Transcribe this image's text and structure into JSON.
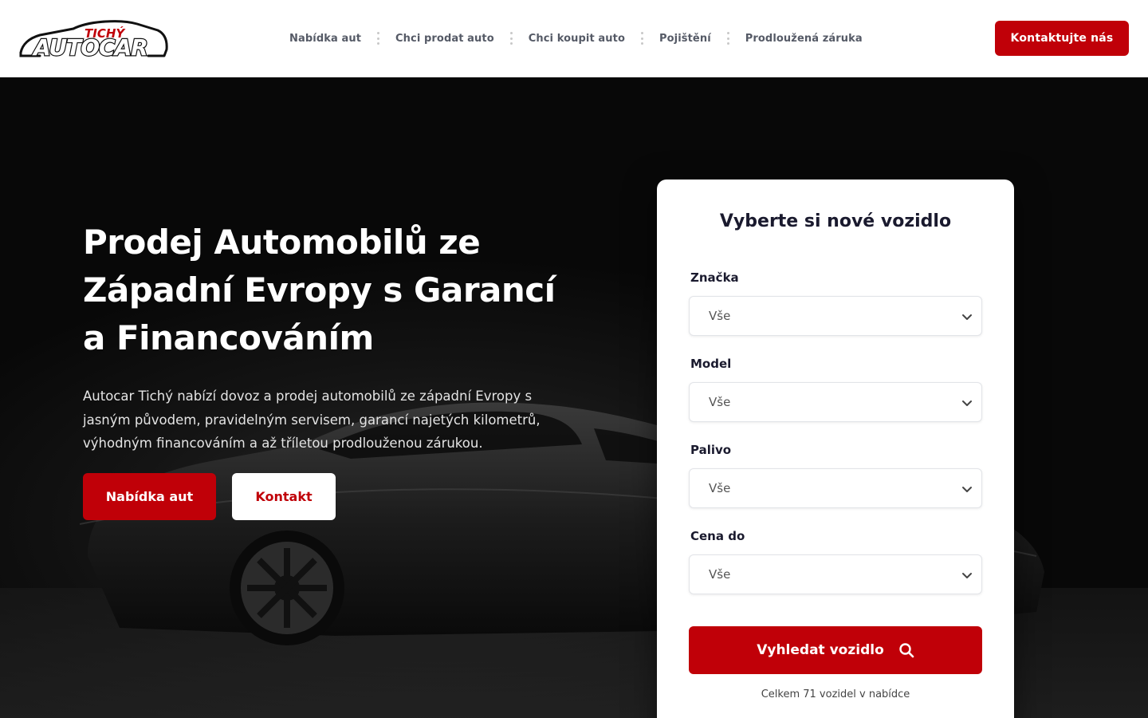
{
  "brand": {
    "logo_text_top": "TICHÝ",
    "logo_text_main": "AUTOCAR",
    "accent_color": "#c00008"
  },
  "nav": {
    "items": [
      {
        "label": "Nabídka aut"
      },
      {
        "label": "Chci prodat auto"
      },
      {
        "label": "Chci koupit auto"
      },
      {
        "label": "Pojištění"
      },
      {
        "label": "Prodloužená záruka"
      }
    ],
    "cta_label": "Kontaktujte nás"
  },
  "hero": {
    "title": "Prodej Automobilů ze Západní Evropy s Garancí a Financováním",
    "text": "Autocar Tichý nabízí dovoz a prodej automobilů ze západní Evropy s jasným původem, pravidelným servisem, garancí najetých kilometrů, výhodným financováním a až tříletou prodlouženou zárukou.",
    "primary_button": "Nabídka aut",
    "secondary_button": "Kontakt"
  },
  "search": {
    "title": "Vyberte si nové vozidlo",
    "fields": [
      {
        "label": "Značka",
        "value": "Vše"
      },
      {
        "label": "Model",
        "value": "Vše"
      },
      {
        "label": "Palivo",
        "value": "Vše"
      },
      {
        "label": "Cena do",
        "value": "Vše"
      }
    ],
    "button_label": "Vyhledat vozidlo",
    "total_text": "Celkem 71 vozidel v nabídce"
  }
}
